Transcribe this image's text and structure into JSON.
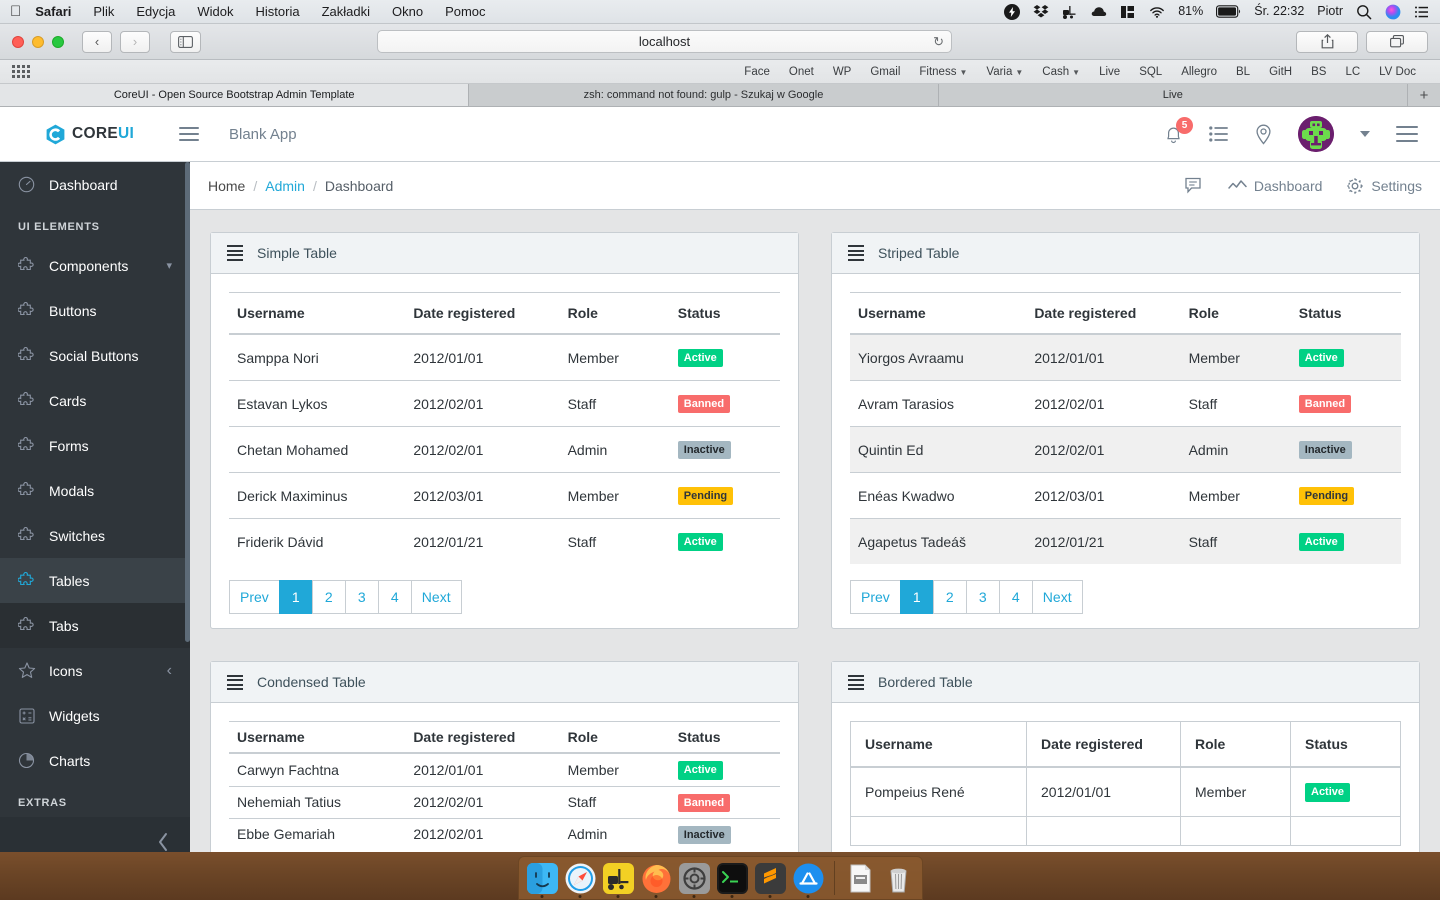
{
  "os": {
    "menubar": {
      "apple_icon": "apple-icon",
      "items": [
        {
          "label": "Safari",
          "bold": true
        },
        {
          "label": "Plik",
          "bold": false
        },
        {
          "label": "Edycja",
          "bold": false
        },
        {
          "label": "Widok",
          "bold": false
        },
        {
          "label": "Historia",
          "bold": false
        },
        {
          "label": "Zakładki",
          "bold": false
        },
        {
          "label": "Okno",
          "bold": false
        },
        {
          "label": "Pomoc",
          "bold": false
        }
      ],
      "status_icons": [
        "flash-icon",
        "dropbox-icon",
        "forklift-icon",
        "cloud-icon",
        "window-layout-icon",
        "wifi-icon"
      ],
      "battery_percent": "81%",
      "clock": "Śr. 22:32",
      "user": "Piotr",
      "search_icon": "search-icon",
      "siri_icon": "siri-icon",
      "control-center_icon": "list-icon"
    }
  },
  "browser": {
    "back_icon": "chevron-left-icon",
    "forward_icon": "chevron-right-icon",
    "sidebar_icon": "sidebar-icon",
    "url": "localhost",
    "reload_icon": "reload-icon",
    "share_icon": "share-icon",
    "tabs_overview_icon": "tabs-icon",
    "bookmarks": [
      {
        "label": "Face",
        "dropdown": false
      },
      {
        "label": "Onet",
        "dropdown": false
      },
      {
        "label": "WP",
        "dropdown": false
      },
      {
        "label": "Gmail",
        "dropdown": false
      },
      {
        "label": "Fitness",
        "dropdown": true
      },
      {
        "label": "Varia",
        "dropdown": true
      },
      {
        "label": "Cash",
        "dropdown": true
      },
      {
        "label": "Live",
        "dropdown": false
      },
      {
        "label": "SQL",
        "dropdown": false
      },
      {
        "label": "Allegro",
        "dropdown": false
      },
      {
        "label": "BL",
        "dropdown": false
      },
      {
        "label": "GitH",
        "dropdown": false
      },
      {
        "label": "BS",
        "dropdown": false
      },
      {
        "label": "LC",
        "dropdown": false
      },
      {
        "label": "LV Doc",
        "dropdown": false
      }
    ],
    "tabs": [
      {
        "label": "CoreUI - Open Source Bootstrap Admin Template",
        "active": true
      },
      {
        "label": "zsh: command not found: gulp - Szukaj w Google",
        "active": false
      },
      {
        "label": "Live",
        "active": false
      }
    ],
    "new_tab_label": "+"
  },
  "app": {
    "brand": {
      "name_dark": "CORE",
      "name_accent": "UI",
      "logo_icon": "coreui-logo-icon"
    },
    "menu_toggle_icon": "hamburger-icon",
    "title": "Blank App",
    "header_actions": {
      "bell_icon": "bell-icon",
      "bell_badge": "5",
      "list_icon": "task-list-icon",
      "location_icon": "map-pin-icon",
      "avatar": "user-avatar",
      "caret_icon": "caret-down-icon",
      "aside_toggle_icon": "hamburger-icon"
    },
    "sidebar": {
      "items": [
        {
          "label": "Dashboard",
          "icon": "speedometer-icon",
          "state": "default",
          "caret": null
        },
        {
          "label": "UI ELEMENTS",
          "icon": null,
          "state": "title",
          "caret": null
        },
        {
          "label": "Components",
          "icon": "puzzle-icon",
          "state": "default",
          "caret": "chevron-down-icon"
        },
        {
          "label": "Buttons",
          "icon": "puzzle-icon",
          "state": "default",
          "caret": null
        },
        {
          "label": "Social Buttons",
          "icon": "puzzle-icon",
          "state": "default",
          "caret": null
        },
        {
          "label": "Cards",
          "icon": "puzzle-icon",
          "state": "default",
          "caret": null
        },
        {
          "label": "Forms",
          "icon": "puzzle-icon",
          "state": "default",
          "caret": null
        },
        {
          "label": "Modals",
          "icon": "puzzle-icon",
          "state": "default",
          "caret": null
        },
        {
          "label": "Switches",
          "icon": "puzzle-icon",
          "state": "default",
          "caret": null
        },
        {
          "label": "Tables",
          "icon": "puzzle-icon",
          "state": "active",
          "caret": null
        },
        {
          "label": "Tabs",
          "icon": "puzzle-icon",
          "state": "hover",
          "caret": null
        },
        {
          "label": "Icons",
          "icon": "star-icon",
          "state": "default",
          "caret": "chevron-left-icon"
        },
        {
          "label": "Widgets",
          "icon": "calculator-icon",
          "state": "default",
          "caret": null
        },
        {
          "label": "Charts",
          "icon": "pie-chart-icon",
          "state": "default",
          "caret": null
        },
        {
          "label": "EXTRAS",
          "icon": null,
          "state": "title",
          "caret": null
        }
      ],
      "minimizer_icon": "chevron-left-icon"
    },
    "breadcrumb": {
      "items": [
        {
          "label": "Home",
          "link": false
        },
        {
          "label": "Admin",
          "link": true
        },
        {
          "label": "Dashboard",
          "link": false
        }
      ],
      "separator": "/",
      "actions": [
        {
          "label": "",
          "icon": "speech-bubble-icon"
        },
        {
          "label": "Dashboard",
          "icon": "graph-icon"
        },
        {
          "label": "Settings",
          "icon": "gear-icon"
        }
      ]
    },
    "columns": [
      "Username",
      "Date registered",
      "Role",
      "Status"
    ],
    "pagination": {
      "prev": "Prev",
      "pages": [
        "1",
        "2",
        "3",
        "4"
      ],
      "active": "1",
      "next": "Next"
    },
    "cards": [
      {
        "title": "Simple Table",
        "icon": "table-icon",
        "variant": "simple",
        "rows": [
          {
            "username": "Samppa Nori",
            "date": "2012/01/01",
            "role": "Member",
            "status": "Active",
            "status_type": "success"
          },
          {
            "username": "Estavan Lykos",
            "date": "2012/02/01",
            "role": "Staff",
            "status": "Banned",
            "status_type": "danger"
          },
          {
            "username": "Chetan Mohamed",
            "date": "2012/02/01",
            "role": "Admin",
            "status": "Inactive",
            "status_type": "secondary"
          },
          {
            "username": "Derick Maximinus",
            "date": "2012/03/01",
            "role": "Member",
            "status": "Pending",
            "status_type": "warning"
          },
          {
            "username": "Friderik Dávid",
            "date": "2012/01/21",
            "role": "Staff",
            "status": "Active",
            "status_type": "success"
          }
        ],
        "has_pagination": true
      },
      {
        "title": "Striped Table",
        "icon": "table-icon",
        "variant": "striped",
        "rows": [
          {
            "username": "Yiorgos Avraamu",
            "date": "2012/01/01",
            "role": "Member",
            "status": "Active",
            "status_type": "success"
          },
          {
            "username": "Avram Tarasios",
            "date": "2012/02/01",
            "role": "Staff",
            "status": "Banned",
            "status_type": "danger"
          },
          {
            "username": "Quintin Ed",
            "date": "2012/02/01",
            "role": "Admin",
            "status": "Inactive",
            "status_type": "secondary"
          },
          {
            "username": "Enéas Kwadwo",
            "date": "2012/03/01",
            "role": "Member",
            "status": "Pending",
            "status_type": "warning"
          },
          {
            "username": "Agapetus Tadeáš",
            "date": "2012/01/21",
            "role": "Staff",
            "status": "Active",
            "status_type": "success"
          }
        ],
        "has_pagination": true
      },
      {
        "title": "Condensed Table",
        "icon": "table-icon",
        "variant": "condensed",
        "rows": [
          {
            "username": "Carwyn Fachtna",
            "date": "2012/01/01",
            "role": "Member",
            "status": "Active",
            "status_type": "success"
          },
          {
            "username": "Nehemiah Tatius",
            "date": "2012/02/01",
            "role": "Staff",
            "status": "Banned",
            "status_type": "danger"
          },
          {
            "username": "Ebbe Gemariah",
            "date": "2012/02/01",
            "role": "Admin",
            "status": "Inactive",
            "status_type": "secondary"
          }
        ],
        "has_pagination": false
      },
      {
        "title": "Bordered Table",
        "icon": "table-icon",
        "variant": "bordered",
        "rows": [
          {
            "username": "Pompeius René",
            "date": "2012/01/01",
            "role": "Member",
            "status": "Active",
            "status_type": "success"
          },
          {
            "username": "",
            "date": "",
            "role": "",
            "status": "",
            "status_type": "none"
          }
        ],
        "has_pagination": false
      }
    ]
  },
  "dock": {
    "items": [
      {
        "name": "finder-icon"
      },
      {
        "name": "safari-icon"
      },
      {
        "name": "forklift-icon"
      },
      {
        "name": "firefox-icon"
      },
      {
        "name": "system-preferences-icon"
      },
      {
        "name": "terminal-icon"
      },
      {
        "name": "sublime-text-icon"
      },
      {
        "name": "app-store-icon"
      }
    ],
    "right_items": [
      {
        "name": "document-icon"
      },
      {
        "name": "trash-icon"
      }
    ]
  },
  "colors": {
    "accent": "#20a8d8",
    "sidebar_bg": "#2f353a",
    "success": "#00d185",
    "danger": "#f86c6b",
    "secondary": "#a4b7c1",
    "warning": "#ffc107"
  }
}
